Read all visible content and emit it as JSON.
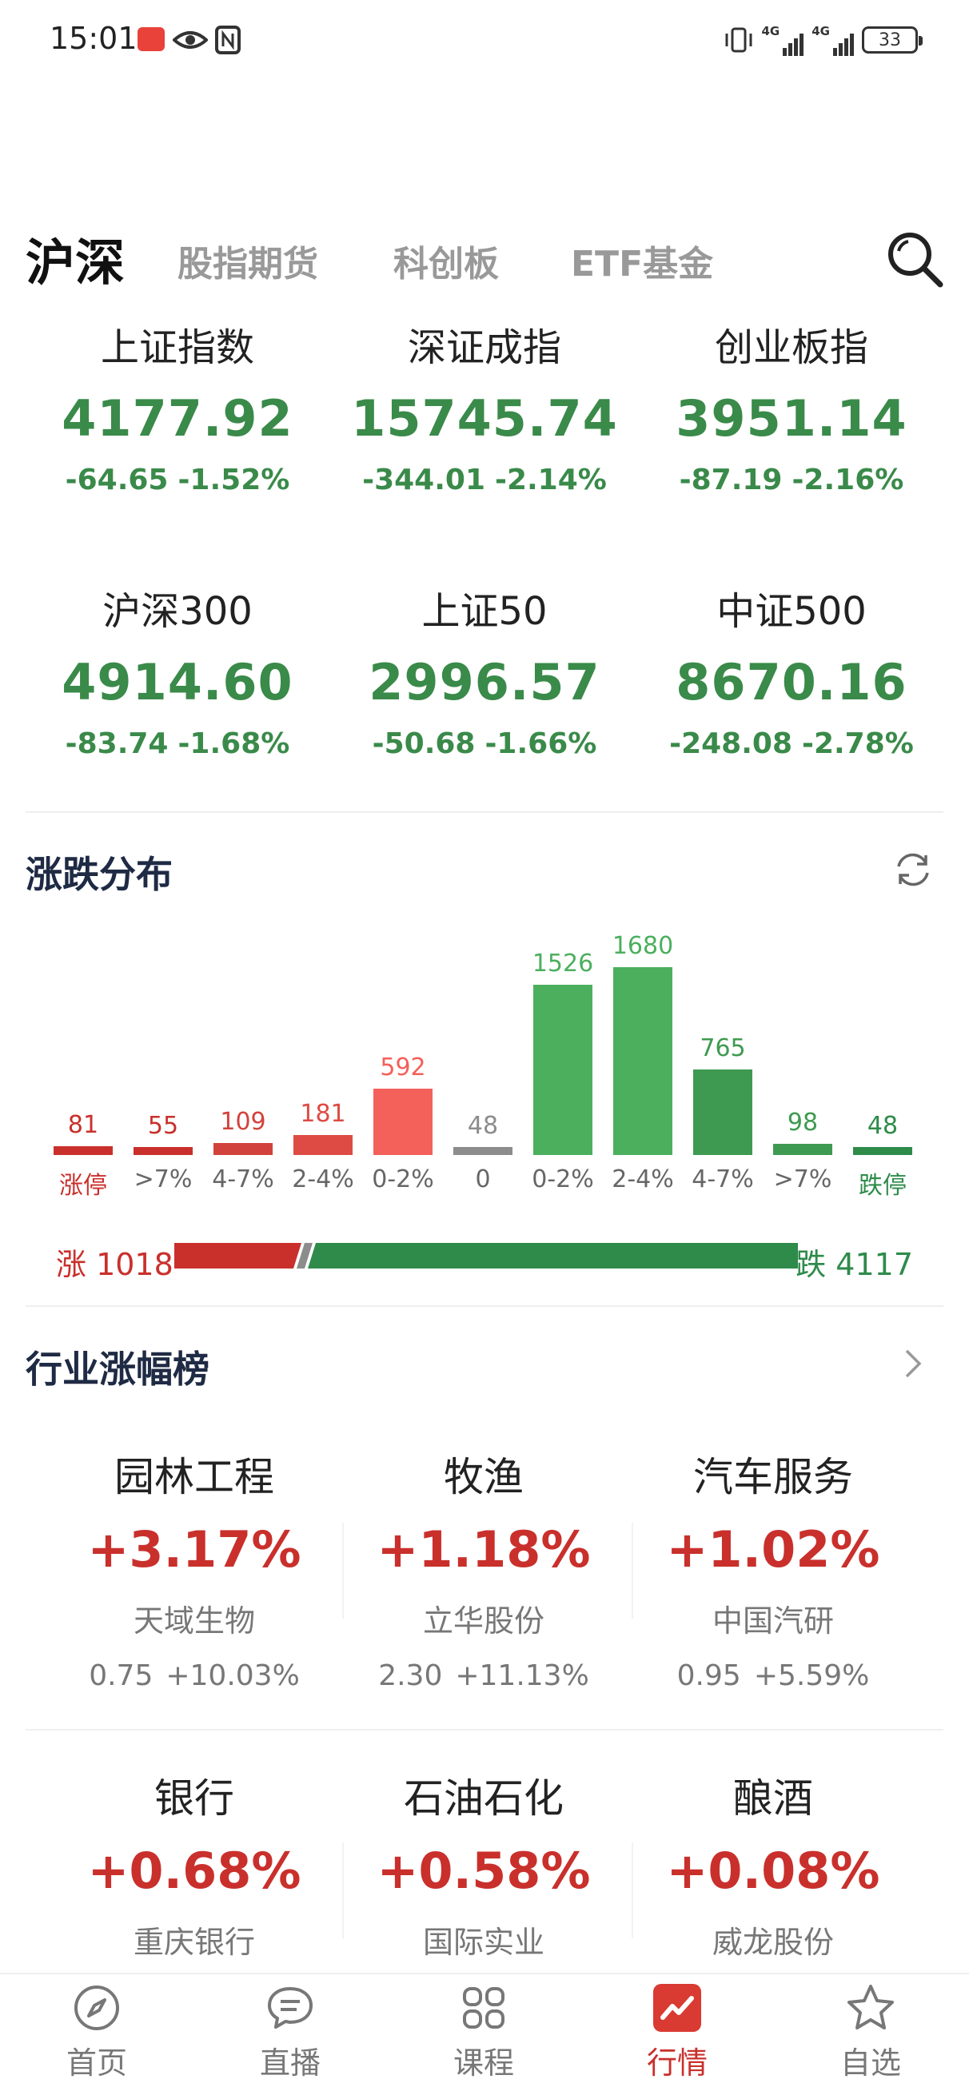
{
  "status_bar": {
    "time": "15:01",
    "battery": "33",
    "net1": "4G",
    "net2": "4G"
  },
  "tabs": [
    {
      "label": "沪深",
      "active": true
    },
    {
      "label": "股指期货",
      "active": false
    },
    {
      "label": "科创板",
      "active": false
    },
    {
      "label": "ETF基金",
      "active": false
    }
  ],
  "indices": [
    {
      "name": "上证指数",
      "value": "4177.92",
      "change": "-64.65",
      "pct": "-1.52%"
    },
    {
      "name": "深证成指",
      "value": "15745.74",
      "change": "-344.01",
      "pct": "-2.14%"
    },
    {
      "name": "创业板指",
      "value": "3951.14",
      "change": "-87.19",
      "pct": "-2.16%"
    },
    {
      "name": "沪深300",
      "value": "4914.60",
      "change": "-83.74",
      "pct": "-1.68%"
    },
    {
      "name": "上证50",
      "value": "2996.57",
      "change": "-50.68",
      "pct": "-1.66%"
    },
    {
      "name": "中证500",
      "value": "8670.16",
      "change": "-248.08",
      "pct": "-2.78%"
    }
  ],
  "distribution": {
    "title": "涨跌分布",
    "colors": {
      "up": "#c9302c",
      "up_light": "#f4605a",
      "flat": "#8c8c8c",
      "down": "#4caf5e",
      "down_dark": "#3e9a50"
    }
  },
  "chart_data": {
    "type": "bar",
    "categories": [
      "涨停",
      ">7%",
      "4-7%",
      "2-4%",
      "0-2%",
      "0",
      "0-2%",
      "2-4%",
      "4-7%",
      ">7%",
      "跌停"
    ],
    "values": [
      81,
      55,
      109,
      181,
      592,
      48,
      1526,
      1680,
      765,
      98,
      48
    ],
    "colors": [
      "#c9302c",
      "#c9302c",
      "#d2423c",
      "#dd4b44",
      "#f4605a",
      "#8c8c8c",
      "#4caf5e",
      "#4caf5e",
      "#3e9a50",
      "#3e9a50",
      "#2e8b4a"
    ],
    "ylim": [
      0,
      1680
    ]
  },
  "ratio": {
    "up_label": "涨 1018",
    "down_label": "跌 4117",
    "up": 1018,
    "down": 4117
  },
  "industry": {
    "title": "行业涨幅榜",
    "items": [
      {
        "name": "园林工程",
        "pct": "+3.17%",
        "stock": "天域生物",
        "price": "0.75",
        "stock_pct": "+10.03%"
      },
      {
        "name": "牧渔",
        "pct": "+1.18%",
        "stock": "立华股份",
        "price": "2.30",
        "stock_pct": "+11.13%"
      },
      {
        "name": "汽车服务",
        "pct": "+1.02%",
        "stock": "中国汽研",
        "price": "0.95",
        "stock_pct": "+5.59%"
      },
      {
        "name": "银行",
        "pct": "+0.68%",
        "stock": "重庆银行"
      },
      {
        "name": "石油石化",
        "pct": "+0.58%",
        "stock": "国际实业"
      },
      {
        "name": "酿酒",
        "pct": "+0.08%",
        "stock": "威龙股份"
      }
    ]
  },
  "bottom_nav": [
    {
      "label": "首页",
      "icon": "compass-icon",
      "active": false
    },
    {
      "label": "直播",
      "icon": "chat-bubble-icon",
      "active": false
    },
    {
      "label": "课程",
      "icon": "grid-icon",
      "active": false
    },
    {
      "label": "行情",
      "icon": "chart-icon",
      "active": true
    },
    {
      "label": "自选",
      "icon": "star-icon",
      "active": false
    }
  ]
}
